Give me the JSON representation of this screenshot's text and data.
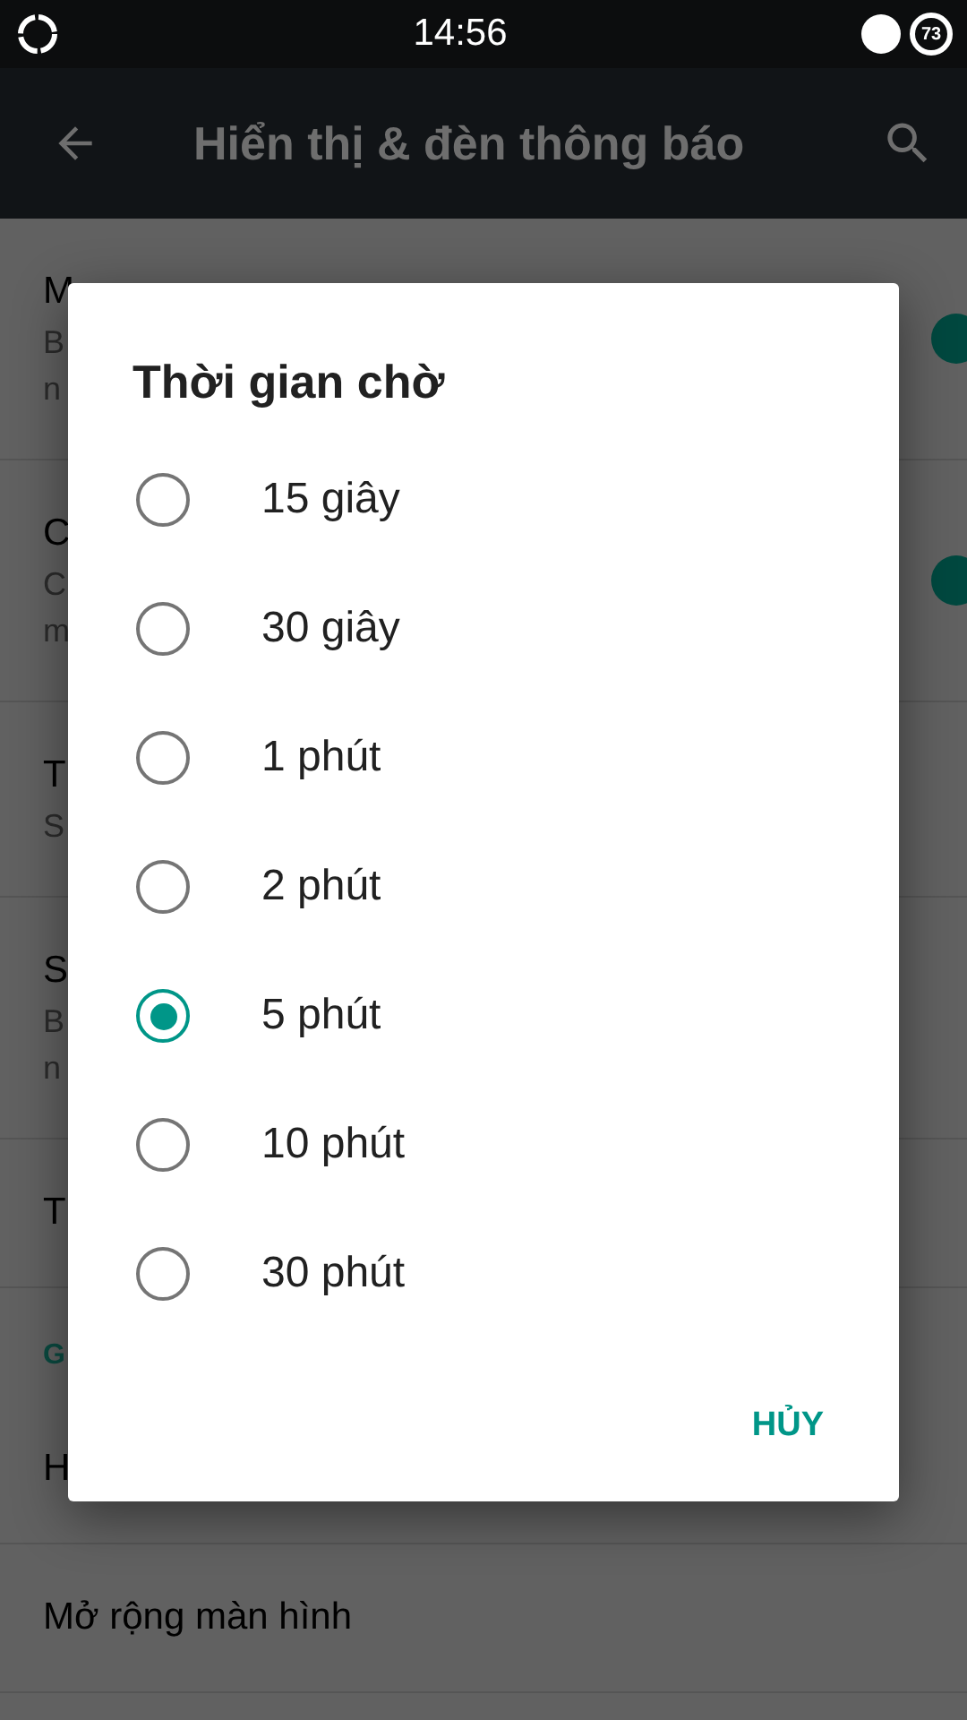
{
  "status_bar": {
    "time": "14:56",
    "battery": "73"
  },
  "app_bar": {
    "title": "Hiển thị & đèn thông báo"
  },
  "settings": [
    {
      "kind": "item",
      "title": "M",
      "summary": [
        "B",
        "n"
      ],
      "switch_on": true
    },
    {
      "kind": "item",
      "title": "C",
      "summary": [
        "C",
        "m"
      ],
      "switch_on": true
    },
    {
      "kind": "item",
      "title": "T",
      "summary": [
        "S"
      ]
    },
    {
      "kind": "item",
      "title": "S",
      "summary": [
        "B",
        "n"
      ]
    },
    {
      "kind": "item",
      "title": "T"
    },
    {
      "kind": "header",
      "title": "G"
    },
    {
      "kind": "item",
      "title": "H"
    },
    {
      "kind": "item",
      "title": "Mở rộng màn hình"
    }
  ],
  "dialog": {
    "title": "Thời gian chờ",
    "options": [
      {
        "label": "15 giây",
        "selected": false
      },
      {
        "label": "30 giây",
        "selected": false
      },
      {
        "label": "1 phút",
        "selected": false
      },
      {
        "label": "2 phút",
        "selected": false
      },
      {
        "label": "5 phút",
        "selected": true
      },
      {
        "label": "10 phút",
        "selected": false
      },
      {
        "label": "30 phút",
        "selected": false
      }
    ],
    "cancel": "HỦY"
  }
}
